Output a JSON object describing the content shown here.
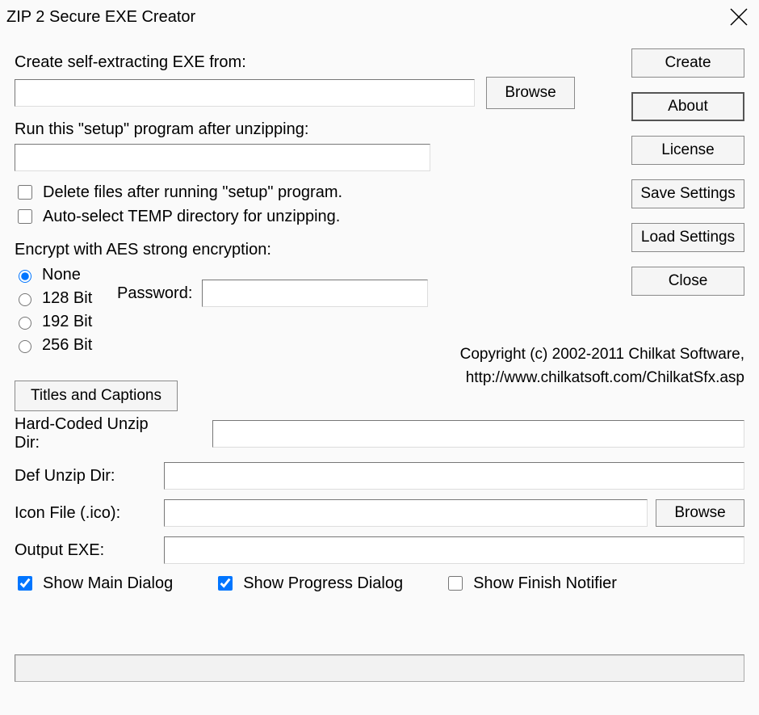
{
  "window": {
    "title": "ZIP 2 Secure EXE Creator"
  },
  "labels": {
    "source": "Create self-extracting EXE from:",
    "browse": "Browse",
    "setup": "Run this \"setup\" program after unzipping:",
    "deleteAfter": "Delete files after running \"setup\" program.",
    "autoTemp": "Auto-select TEMP directory for unzipping.",
    "encryptHeader": "Encrypt with AES strong encryption:",
    "radio_none": "None",
    "radio_128": "128 Bit",
    "radio_192": "192 Bit",
    "radio_256": "256 Bit",
    "password": "Password:",
    "titlesCaptions": "Titles and Captions",
    "hardCoded": "Hard-Coded Unzip Dir:",
    "defUnzip": "Def Unzip Dir:",
    "iconFile": "Icon File (.ico):",
    "outputExe": "Output EXE:",
    "showMain": "Show Main Dialog",
    "showProgress": "Show Progress Dialog",
    "showFinish": "Show Finish Notifier"
  },
  "sideButtons": {
    "create": "Create",
    "about": "About",
    "license": "License",
    "saveSettings": "Save Settings",
    "loadSettings": "Load Settings",
    "close": "Close"
  },
  "values": {
    "sourcePath": "",
    "setupProgram": "",
    "deleteAfter": false,
    "autoTemp": false,
    "encryption": "none",
    "password": "",
    "hardCodedDir": "",
    "defUnzipDir": "",
    "iconFile": "",
    "outputExe": "",
    "showMain": true,
    "showProgress": true,
    "showFinish": false,
    "status": ""
  },
  "copyright": {
    "line1": "Copyright (c) 2002-2011 Chilkat Software,",
    "line2": "http://www.chilkatsoft.com/ChilkatSfx.asp"
  }
}
